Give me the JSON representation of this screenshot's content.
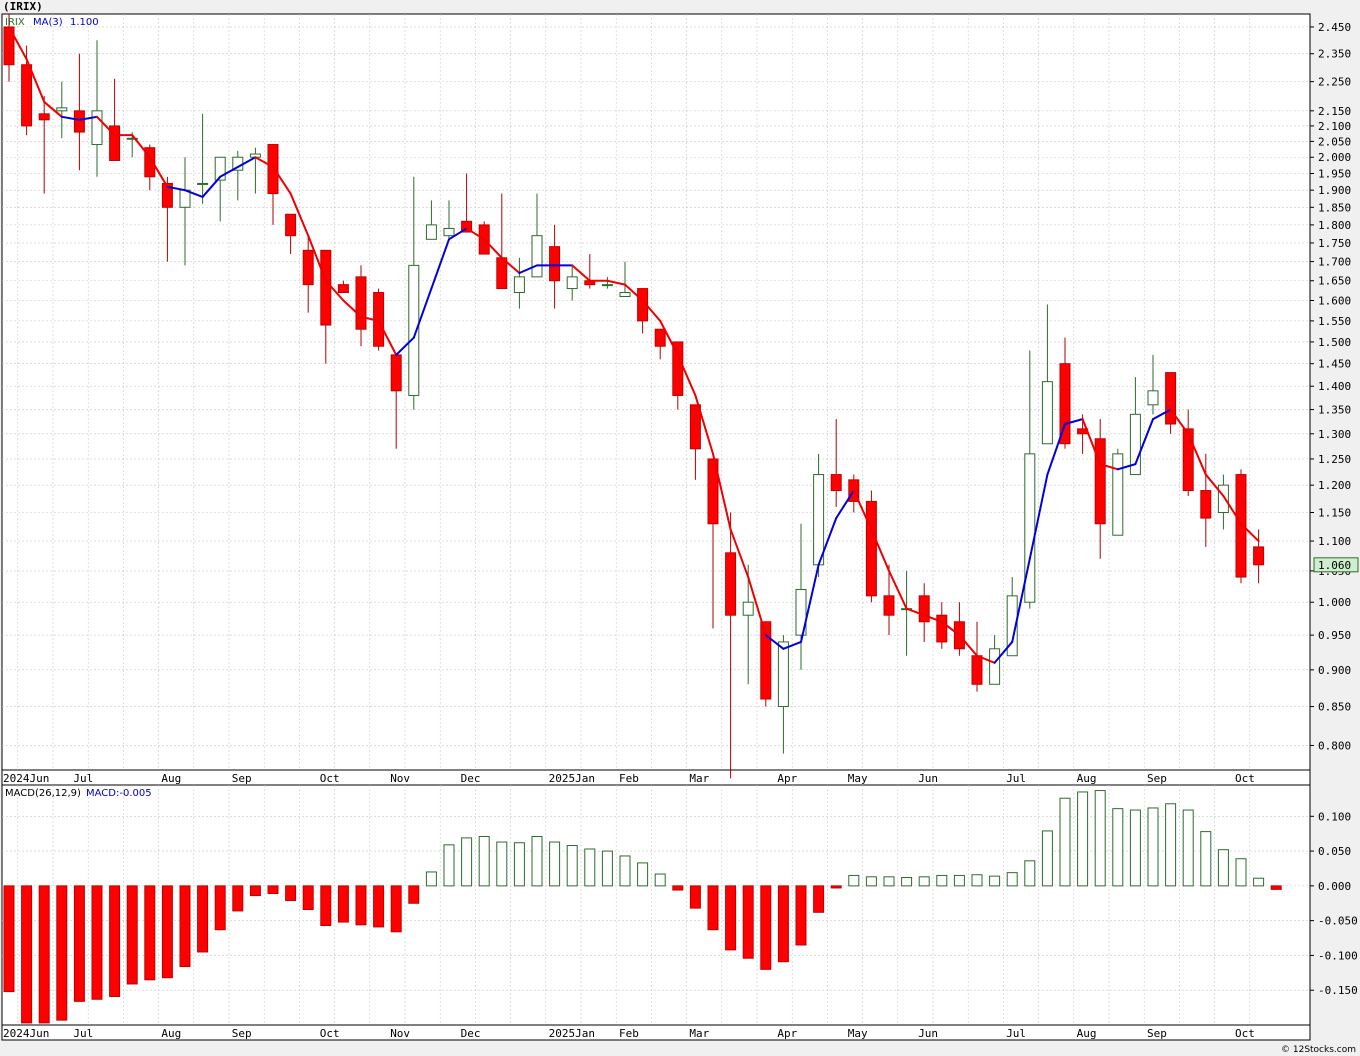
{
  "title": "(IRIX)",
  "credit": "© 12Stocks.com",
  "colors": {
    "up": "#2e6b2e",
    "down": "#ff0000",
    "ma_up": "#0000dd",
    "ma_down": "#ee0000",
    "grid": "#c8c8c8",
    "panel_bg": "#ffffff",
    "last_price_bg": "#cfeecf"
  },
  "chart_data": [
    {
      "type": "candlestick",
      "legend": {
        "symbol": "IRIX",
        "ma_label": "MA(3)",
        "ma_value": "1.100"
      },
      "last_price_label": "1.060",
      "ylim": [
        0.77,
        2.5
      ],
      "y_scale": "log",
      "y_ticks": [
        "2.450",
        "2.350",
        "2.250",
        "2.150",
        "2.100",
        "2.050",
        "2.000",
        "1.950",
        "1.900",
        "1.850",
        "1.800",
        "1.750",
        "1.700",
        "1.650",
        "1.600",
        "1.550",
        "1.500",
        "1.450",
        "1.400",
        "1.350",
        "1.300",
        "1.250",
        "1.200",
        "1.150",
        "1.100",
        "1.050",
        "1.000",
        "0.950",
        "0.900",
        "0.850",
        "0.800"
      ],
      "x_ticks": [
        {
          "label": "2024Jun",
          "i": 0
        },
        {
          "label": "Jul",
          "i": 4
        },
        {
          "label": "Aug",
          "i": 9
        },
        {
          "label": "Sep",
          "i": 13
        },
        {
          "label": "Oct",
          "i": 18
        },
        {
          "label": "Nov",
          "i": 22
        },
        {
          "label": "Dec",
          "i": 26
        },
        {
          "label": "2025Jan",
          "i": 31
        },
        {
          "label": "Feb",
          "i": 35
        },
        {
          "label": "Mar",
          "i": 39
        },
        {
          "label": "Apr",
          "i": 44
        },
        {
          "label": "May",
          "i": 48
        },
        {
          "label": "Jun",
          "i": 52
        },
        {
          "label": "Jul",
          "i": 57
        },
        {
          "label": "Aug",
          "i": 61
        },
        {
          "label": "Sep",
          "i": 65
        },
        {
          "label": "Oct",
          "i": 70
        }
      ],
      "ohlc": [
        [
          2.45,
          2.5,
          2.25,
          2.31
        ],
        [
          2.31,
          2.38,
          2.07,
          2.1
        ],
        [
          2.14,
          2.2,
          1.89,
          2.12
        ],
        [
          2.15,
          2.25,
          2.06,
          2.16
        ],
        [
          2.15,
          2.35,
          1.96,
          2.08
        ],
        [
          2.04,
          2.4,
          1.94,
          2.15
        ],
        [
          2.1,
          2.26,
          1.99,
          1.99
        ],
        [
          2.06,
          2.08,
          2.0,
          2.06
        ],
        [
          2.03,
          2.04,
          1.9,
          1.94
        ],
        [
          1.92,
          1.94,
          1.7,
          1.85
        ],
        [
          1.85,
          2.0,
          1.69,
          1.9
        ],
        [
          1.92,
          2.14,
          1.86,
          1.92
        ],
        [
          1.93,
          2.0,
          1.81,
          2.0
        ],
        [
          1.96,
          2.02,
          1.87,
          2.0
        ],
        [
          2.0,
          2.03,
          1.89,
          2.01
        ],
        [
          2.04,
          2.04,
          1.8,
          1.89
        ],
        [
          1.83,
          1.83,
          1.72,
          1.77
        ],
        [
          1.73,
          1.77,
          1.57,
          1.64
        ],
        [
          1.73,
          1.73,
          1.45,
          1.54
        ],
        [
          1.64,
          1.65,
          1.62,
          1.62
        ],
        [
          1.66,
          1.69,
          1.49,
          1.53
        ],
        [
          1.62,
          1.63,
          1.48,
          1.49
        ],
        [
          1.47,
          1.47,
          1.27,
          1.39
        ],
        [
          1.38,
          1.94,
          1.35,
          1.69
        ],
        [
          1.76,
          1.87,
          1.76,
          1.8
        ],
        [
          1.77,
          1.87,
          1.76,
          1.79
        ],
        [
          1.81,
          1.95,
          1.79,
          1.78
        ],
        [
          1.8,
          1.81,
          1.72,
          1.72
        ],
        [
          1.71,
          1.89,
          1.63,
          1.63
        ],
        [
          1.62,
          1.71,
          1.58,
          1.66
        ],
        [
          1.66,
          1.89,
          1.66,
          1.77
        ],
        [
          1.74,
          1.8,
          1.58,
          1.65
        ],
        [
          1.63,
          1.69,
          1.6,
          1.66
        ],
        [
          1.65,
          1.72,
          1.63,
          1.64
        ],
        [
          1.64,
          1.66,
          1.63,
          1.64
        ],
        [
          1.61,
          1.7,
          1.61,
          1.62
        ],
        [
          1.63,
          1.63,
          1.52,
          1.55
        ],
        [
          1.53,
          1.53,
          1.46,
          1.49
        ],
        [
          1.5,
          1.5,
          1.35,
          1.38
        ],
        [
          1.36,
          1.36,
          1.21,
          1.27
        ],
        [
          1.25,
          1.25,
          0.96,
          1.13
        ],
        [
          1.08,
          1.15,
          0.76,
          0.98
        ],
        [
          0.98,
          1.06,
          0.88,
          1.0
        ],
        [
          0.97,
          0.97,
          0.85,
          0.86
        ],
        [
          0.85,
          0.95,
          0.79,
          0.94
        ],
        [
          0.95,
          1.13,
          0.9,
          1.02
        ],
        [
          1.06,
          1.26,
          1.04,
          1.22
        ],
        [
          1.22,
          1.33,
          1.16,
          1.19
        ],
        [
          1.21,
          1.22,
          1.15,
          1.17
        ],
        [
          1.17,
          1.19,
          1.0,
          1.01
        ],
        [
          1.01,
          1.06,
          0.95,
          0.98
        ],
        [
          0.99,
          1.05,
          0.92,
          0.99
        ],
        [
          1.01,
          1.03,
          0.94,
          0.97
        ],
        [
          0.98,
          1.0,
          0.93,
          0.94
        ],
        [
          0.97,
          1.0,
          0.92,
          0.93
        ],
        [
          0.92,
          0.97,
          0.87,
          0.88
        ],
        [
          0.88,
          0.95,
          0.88,
          0.93
        ],
        [
          0.92,
          1.04,
          0.92,
          1.01
        ],
        [
          1.0,
          1.48,
          0.99,
          1.26
        ],
        [
          1.28,
          1.59,
          1.29,
          1.41
        ],
        [
          1.45,
          1.51,
          1.27,
          1.28
        ],
        [
          1.31,
          1.34,
          1.26,
          1.3
        ],
        [
          1.29,
          1.33,
          1.07,
          1.13
        ],
        [
          1.11,
          1.27,
          1.11,
          1.26
        ],
        [
          1.22,
          1.42,
          1.22,
          1.34
        ],
        [
          1.36,
          1.47,
          1.34,
          1.39
        ],
        [
          1.43,
          1.43,
          1.3,
          1.32
        ],
        [
          1.31,
          1.35,
          1.18,
          1.19
        ],
        [
          1.19,
          1.26,
          1.09,
          1.14
        ],
        [
          1.15,
          1.22,
          1.12,
          1.2
        ],
        [
          1.22,
          1.23,
          1.03,
          1.04
        ],
        [
          1.09,
          1.12,
          1.03,
          1.06
        ]
      ],
      "ma3": [
        2.45,
        2.33,
        2.18,
        2.13,
        2.12,
        2.13,
        2.07,
        2.07,
        2.0,
        1.91,
        1.9,
        1.88,
        1.94,
        1.97,
        2.0,
        1.97,
        1.89,
        1.77,
        1.65,
        1.6,
        1.56,
        1.55,
        1.47,
        1.51,
        1.63,
        1.76,
        1.79,
        1.76,
        1.71,
        1.67,
        1.69,
        1.69,
        1.69,
        1.65,
        1.65,
        1.64,
        1.6,
        1.55,
        1.47,
        1.38,
        1.26,
        1.12,
        1.04,
        0.95,
        0.93,
        0.94,
        1.06,
        1.14,
        1.19,
        1.12,
        1.05,
        0.99,
        0.98,
        0.97,
        0.95,
        0.92,
        0.91,
        0.94,
        1.07,
        1.22,
        1.32,
        1.33,
        1.24,
        1.23,
        1.24,
        1.33,
        1.35,
        1.3,
        1.22,
        1.18,
        1.13,
        1.1
      ],
      "ma3_up": [
        false,
        false,
        false,
        false,
        true,
        true,
        false,
        false,
        false,
        false,
        true,
        true,
        true,
        true,
        true,
        false,
        false,
        false,
        false,
        false,
        false,
        false,
        false,
        true,
        true,
        true,
        true,
        false,
        false,
        false,
        true,
        true,
        true,
        false,
        false,
        false,
        false,
        false,
        false,
        false,
        false,
        false,
        false,
        false,
        true,
        true,
        true,
        true,
        true,
        false,
        false,
        false,
        false,
        false,
        false,
        false,
        false,
        true,
        true,
        true,
        true,
        true,
        false,
        false,
        true,
        true,
        true,
        false,
        false,
        false,
        false,
        false
      ]
    },
    {
      "type": "bar",
      "legend": {
        "name": "MACD(26,12,9)",
        "value_label": "MACD:-0.005"
      },
      "ylim": [
        -0.2,
        0.145
      ],
      "y_ticks": [
        "0.100",
        "0.050",
        "0.000",
        "-0.050",
        "-0.100",
        "-0.150"
      ],
      "values": [
        -0.152,
        -0.197,
        -0.197,
        -0.193,
        -0.166,
        -0.163,
        -0.159,
        -0.141,
        -0.135,
        -0.132,
        -0.116,
        -0.095,
        -0.063,
        -0.036,
        -0.014,
        -0.011,
        -0.021,
        -0.034,
        -0.057,
        -0.052,
        -0.056,
        -0.059,
        -0.066,
        -0.025,
        0.02,
        0.059,
        0.069,
        0.071,
        0.063,
        0.062,
        0.071,
        0.063,
        0.058,
        0.053,
        0.05,
        0.043,
        0.033,
        0.017,
        -0.006,
        -0.032,
        -0.063,
        -0.092,
        -0.104,
        -0.12,
        -0.109,
        -0.085,
        -0.038,
        -0.003,
        0.015,
        0.013,
        0.013,
        0.012,
        0.013,
        0.015,
        0.015,
        0.016,
        0.014,
        0.019,
        0.036,
        0.079,
        0.126,
        0.135,
        0.137,
        0.111,
        0.109,
        0.112,
        0.118,
        0.109,
        0.078,
        0.052,
        0.039,
        0.011,
        -0.005
      ]
    }
  ]
}
